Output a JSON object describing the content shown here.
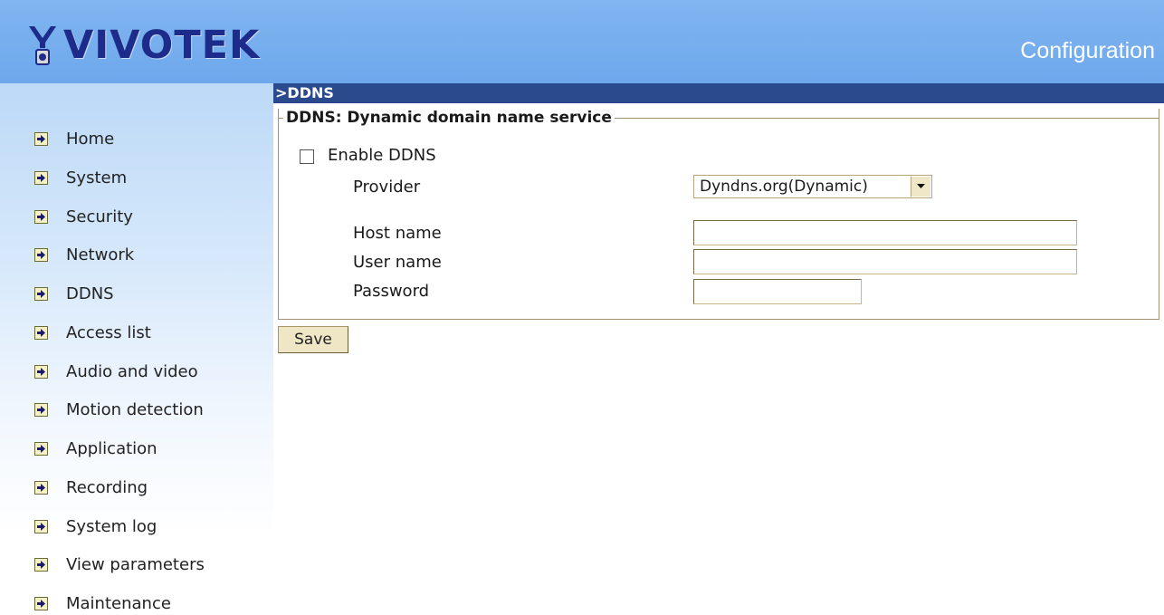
{
  "header": {
    "logo_text": "VIVOTEK",
    "title": "Configuration"
  },
  "sidebar": {
    "items": [
      {
        "label": "Home",
        "name": "sidebar-item-home"
      },
      {
        "label": "System",
        "name": "sidebar-item-system"
      },
      {
        "label": "Security",
        "name": "sidebar-item-security"
      },
      {
        "label": "Network",
        "name": "sidebar-item-network"
      },
      {
        "label": "DDNS",
        "name": "sidebar-item-ddns"
      },
      {
        "label": "Access list",
        "name": "sidebar-item-access-list"
      },
      {
        "label": "Audio and video",
        "name": "sidebar-item-audio-and-video"
      },
      {
        "label": "Motion detection",
        "name": "sidebar-item-motion-detection"
      },
      {
        "label": "Application",
        "name": "sidebar-item-application"
      },
      {
        "label": "Recording",
        "name": "sidebar-item-recording"
      },
      {
        "label": "System log",
        "name": "sidebar-item-system-log"
      },
      {
        "label": "View parameters",
        "name": "sidebar-item-view-parameters"
      },
      {
        "label": "Maintenance",
        "name": "sidebar-item-maintenance"
      }
    ]
  },
  "section": {
    "title": ">DDNS"
  },
  "ddns_form": {
    "legend": "DDNS: Dynamic domain name service",
    "enable_label": "Enable DDNS",
    "enable_checked": false,
    "provider_label": "Provider",
    "provider_value": "Dyndns.org(Dynamic)",
    "host_label": "Host name",
    "host_value": "",
    "user_label": "User name",
    "user_value": "",
    "password_label": "Password",
    "password_value": ""
  },
  "actions": {
    "save_label": "Save"
  },
  "colors": {
    "header_bg": "#6ea8ec",
    "section_bar": "#2b4a8e",
    "logo_text": "#1d2b8a",
    "button_bg": "#efe6c6"
  }
}
